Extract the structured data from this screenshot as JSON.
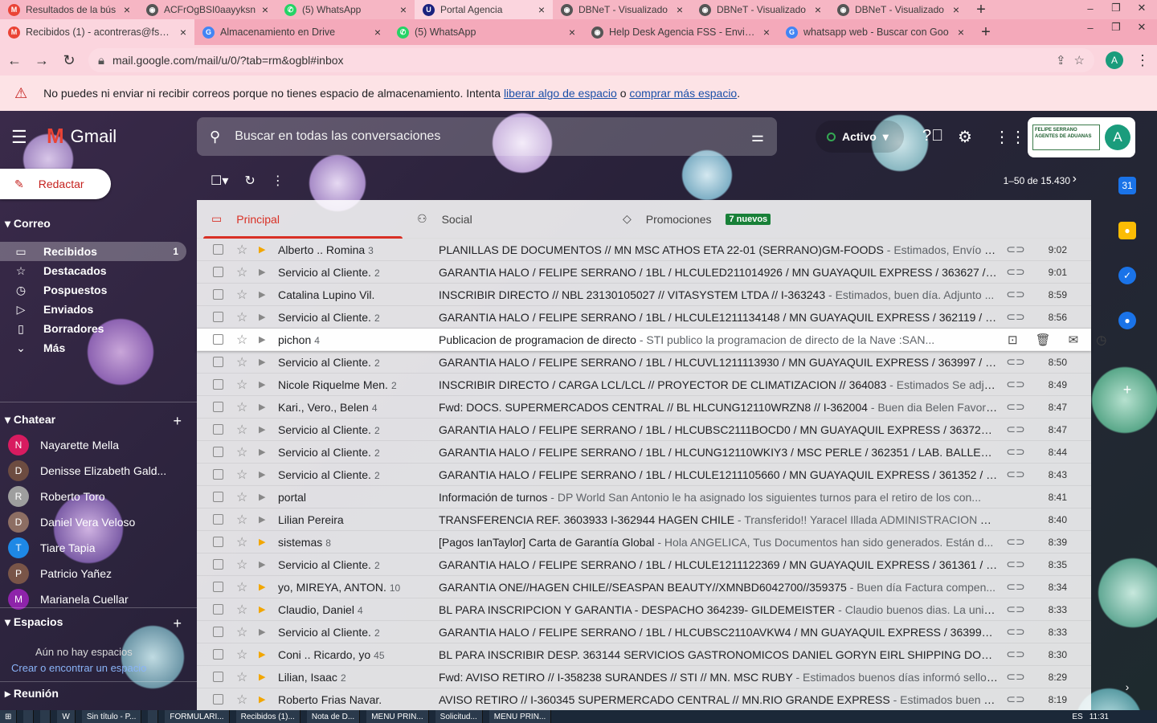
{
  "browser": {
    "tabs_row1": [
      {
        "title": "Resultados de la bús",
        "favicon": "gmail-icon",
        "color": "#ea4335"
      },
      {
        "title": "ACFrOgBSI0aayyksn",
        "favicon": "globe-icon",
        "color": "#555555"
      },
      {
        "title": "(5) WhatsApp",
        "favicon": "whatsapp-icon",
        "color": "#25d366"
      },
      {
        "title": "Portal Agencia",
        "favicon": "u-icon",
        "color": "#1a237e"
      },
      {
        "title": "DBNeT - Visualizado",
        "favicon": "globe-icon",
        "color": "#555555"
      },
      {
        "title": "DBNeT - Visualizado",
        "favicon": "globe-icon",
        "color": "#555555"
      },
      {
        "title": "DBNeT - Visualizado",
        "favicon": "globe-icon",
        "color": "#555555"
      }
    ],
    "tabs_row2": [
      {
        "title": "Recibidos (1) - acontreras@fss.cl",
        "favicon": "gmail-icon",
        "color": "#ea4335"
      },
      {
        "title": "Almacenamiento en Drive",
        "favicon": "google-icon",
        "color": "#4285f4"
      },
      {
        "title": "(5) WhatsApp",
        "favicon": "whatsapp-icon",
        "color": "#25d366"
      },
      {
        "title": "Help Desk Agencia FSS - Enviar u",
        "favicon": "globe-icon",
        "color": "#555555"
      },
      {
        "title": "whatsapp web - Buscar con Goo",
        "favicon": "google-icon",
        "color": "#4285f4"
      }
    ],
    "url": "mail.google.com/mail/u/0/?tab=rm&ogbl#inbox",
    "profile_initial": "A"
  },
  "warning": {
    "text_before": "No puedes ni enviar ni recibir correos porque no tienes espacio de almacenamiento. Intenta ",
    "link1": "liberar algo de espacio",
    "middle": " o ",
    "link2": "comprar más espacio",
    "end": "."
  },
  "gmail": {
    "logo_text": "Gmail",
    "search_placeholder": "Buscar en todas las conversaciones",
    "status": "Activo",
    "brand_text": "FELIPE SERRANO AGENTES DE ADUANAS",
    "avatar_initial": "A",
    "compose": "Redactar",
    "mail_header": "Correo",
    "nav": [
      {
        "label": "Recibidos",
        "icon": "inbox-icon",
        "count": "1"
      },
      {
        "label": "Destacados",
        "icon": "star-icon",
        "count": ""
      },
      {
        "label": "Pospuestos",
        "icon": "clock-icon",
        "count": ""
      },
      {
        "label": "Enviados",
        "icon": "send-icon",
        "count": ""
      },
      {
        "label": "Borradores",
        "icon": "draft-icon",
        "count": ""
      },
      {
        "label": "Más",
        "icon": "chevron-down-icon",
        "count": ""
      }
    ],
    "chat_header": "Chatear",
    "chats": [
      {
        "name": "Nayarette Mella",
        "initial": "N",
        "color": "#d81b60"
      },
      {
        "name": "Denisse Elizabeth Gald...",
        "initial": "D",
        "color": "#6d4c41"
      },
      {
        "name": "Roberto Toro",
        "initial": "R",
        "color": "#9e9e9e"
      },
      {
        "name": "Daniel Vera Veloso",
        "initial": "D",
        "color": "#8d6e63"
      },
      {
        "name": "Tiare Tapia",
        "initial": "T",
        "color": "#1e88e5"
      },
      {
        "name": "Patricio Yañez",
        "initial": "P",
        "color": "#795548"
      },
      {
        "name": "Marianela Cuellar",
        "initial": "M",
        "color": "#8e24aa"
      }
    ],
    "spaces_header": "Espacios",
    "spaces_empty": "Aún no hay espacios",
    "spaces_link": "Crear o encontrar un espacio",
    "meet_header": "Reunión",
    "pager": "1–50 de 15.430",
    "categories": [
      {
        "label": "Principal",
        "icon": "inbox-icon",
        "badge": ""
      },
      {
        "label": "Social",
        "icon": "people-icon",
        "badge": ""
      },
      {
        "label": "Promociones",
        "icon": "tag-icon",
        "badge": "7 nuevos"
      }
    ],
    "emails": [
      {
        "sender": "Alberto .. Romina",
        "count": "3",
        "subject": "PLANILLAS DE DOCUMENTOS // MN MSC ATHOS ETA 22-01 (SERRANO)GM-FOODS",
        "snippet": " - Estimados, Envío vali...",
        "time": "9:02",
        "important": true,
        "clip": true
      },
      {
        "sender": "Servicio al Cliente.",
        "count": "2",
        "subject": "GARANTIA HALO / FELIPE SERRANO / 1BL / HLCULED211014926 / MN GUAYAQUIL EXPRESS / 363627 / I...",
        "snippet": "",
        "time": "9:01",
        "important": false,
        "clip": true
      },
      {
        "sender": "Catalina Lupino Vil.",
        "count": "",
        "subject": "INSCRIBIR DIRECTO // NBL 23130105027 // VITASYSTEM LTDA // I-363243",
        "snippet": " - Estimados, buen día. Adjunto ...",
        "time": "8:59",
        "important": false,
        "clip": true
      },
      {
        "sender": "Servicio al Cliente.",
        "count": "2",
        "subject": "GARANTIA HALO / FELIPE SERRANO / 1BL / HLCULE1211134148 / MN GUAYAQUIL EXPRESS / 362119 / S...",
        "snippet": "",
        "time": "8:56",
        "important": false,
        "clip": true
      },
      {
        "sender": "pichon",
        "count": "4",
        "subject": "Publicacion de programacion de directo",
        "snippet": " - STI publico la programacion de directo de la Nave :SAN...",
        "time": "",
        "important": false,
        "clip": false,
        "hover": true
      },
      {
        "sender": "Servicio al Cliente.",
        "count": "2",
        "subject": "GARANTIA HALO / FELIPE SERRANO / 1BL / HLCUVL1211113930 / MN GUAYAQUIL EXPRESS / 363997 / W...",
        "snippet": "",
        "time": "8:50",
        "important": false,
        "clip": true
      },
      {
        "sender": "Nicole Riquelme Men.",
        "count": "2",
        "subject": "INSCRIBIR DIRECTO / CARGA LCL/LCL // PROYECTOR DE CLIMATIZACION // 364083",
        "snippet": " - Estimados Se adjun...",
        "time": "8:49",
        "important": false,
        "clip": true
      },
      {
        "sender": "Kari., Vero., Belen",
        "count": "4",
        "subject": "Fwd: DOCS. SUPERMERCADOS CENTRAL // BL HLCUNG12110WRZN8 // I-362004",
        "snippet": " - Buen dia Belen Favor su...",
        "time": "8:47",
        "important": false,
        "clip": true
      },
      {
        "sender": "Servicio al Cliente.",
        "count": "2",
        "subject": "GARANTIA HALO / FELIPE SERRANO / 1BL / HLCUBSC2111BOCD0 / MN GUAYAQUIL EXPRESS / 363720 / ...",
        "snippet": "",
        "time": "8:47",
        "important": false,
        "clip": true
      },
      {
        "sender": "Servicio al Cliente.",
        "count": "2",
        "subject": "GARANTIA HALO / FELIPE SERRANO / 1BL / HLCUNG12110WKIY3 / MSC PERLE / 362351 / LAB. BALLERI...",
        "snippet": "",
        "time": "8:44",
        "important": false,
        "clip": true
      },
      {
        "sender": "Servicio al Cliente.",
        "count": "2",
        "subject": "GARANTIA HALO / FELIPE SERRANO / 1BL / HLCULE1211105660 / MN GUAYAQUIL EXPRESS / 361352 / PI...",
        "snippet": "",
        "time": "8:43",
        "important": false,
        "clip": true
      },
      {
        "sender": "portal",
        "count": "",
        "subject": "Información de turnos",
        "snippet": " - DP World San Antonio le ha asignado los siguientes turnos para el retiro de los con...",
        "time": "8:41",
        "important": false,
        "clip": false
      },
      {
        "sender": "Lilian Pereira",
        "count": "",
        "subject": "TRANSFERENCIA REF. 3603933 I-362944 HAGEN CHILE",
        "snippet": " - Transferido!! Yaracel Illada ADMINISTRACION Y F...",
        "time": "8:40",
        "important": false,
        "clip": false
      },
      {
        "sender": "sistemas",
        "count": "8",
        "subject": "[Pagos IanTaylor] Carta de Garantía Global",
        "snippet": " - Hola ANGELICA, Tus Documentos han sido generados. Están d...",
        "time": "8:39",
        "important": true,
        "clip": true
      },
      {
        "sender": "Servicio al Cliente.",
        "count": "2",
        "subject": "GARANTIA HALO / FELIPE SERRANO / 1BL / HLCULE1211122369 / MN GUAYAQUIL EXPRESS / 361361 / PI...",
        "snippet": "",
        "time": "8:35",
        "important": false,
        "clip": true
      },
      {
        "sender": "yo, MIREYA, ANTON.",
        "count": "10",
        "subject": "GARANTIA ONE//HAGEN CHILE//SEASPAN BEAUTY//XMNBD6042700//359375",
        "snippet": " - Buen día Factura compen...",
        "time": "8:34",
        "important": true,
        "clip": true
      },
      {
        "sender": "Claudio, Daniel",
        "count": "4",
        "subject": "BL PARA INSCRIPCION Y GARANTIA - DESPACHO 364239- GILDEMEISTER",
        "snippet": " - Claudio buenos dias. La unidad...",
        "time": "8:33",
        "important": true,
        "clip": true
      },
      {
        "sender": "Servicio al Cliente.",
        "count": "2",
        "subject": "GARANTIA HALO / FELIPE SERRANO / 1BL / HLCUBSC2110AVKW4 / MN GUAYAQUIL EXPRESS / 363994 / ...",
        "snippet": "",
        "time": "8:33",
        "important": false,
        "clip": true
      },
      {
        "sender": "Coni .. Ricardo, yo",
        "count": "45",
        "subject": "BL PARA INSCRIBIR DESP. 363144 SERVICIOS GASTRONOMICOS DANIEL GORYN EIRL SHIPPING DOCUME...",
        "snippet": "",
        "time": "8:30",
        "important": true,
        "clip": true
      },
      {
        "sender": "Lilian, Isaac",
        "count": "2",
        "subject": "Fwd: AVISO RETIRO // I-358238 SURANDES // STI // MN. MSC RUBY",
        "snippet": " - Estimados buenos días informó sello ...",
        "time": "8:29",
        "important": true,
        "clip": true
      },
      {
        "sender": "Roberto Frias Navar.",
        "count": "",
        "subject": "AVISO RETIRO // I-360345 SUPERMERCADO CENTRAL // MN.RIO GRANDE EXPRESS",
        "snippet": " - Estimados buen dia, f...",
        "time": "8:19",
        "important": true,
        "clip": true
      }
    ]
  },
  "taskbar": {
    "items": [
      "",
      "",
      "W",
      "Sin título - P...",
      "",
      "FORMULARI...",
      "Recibidos (1)...",
      "Nota de D...",
      "MENU PRIN...",
      "Solicitud...",
      "MENU PRIN..."
    ],
    "lang": "ES",
    "clock": "11:31"
  }
}
